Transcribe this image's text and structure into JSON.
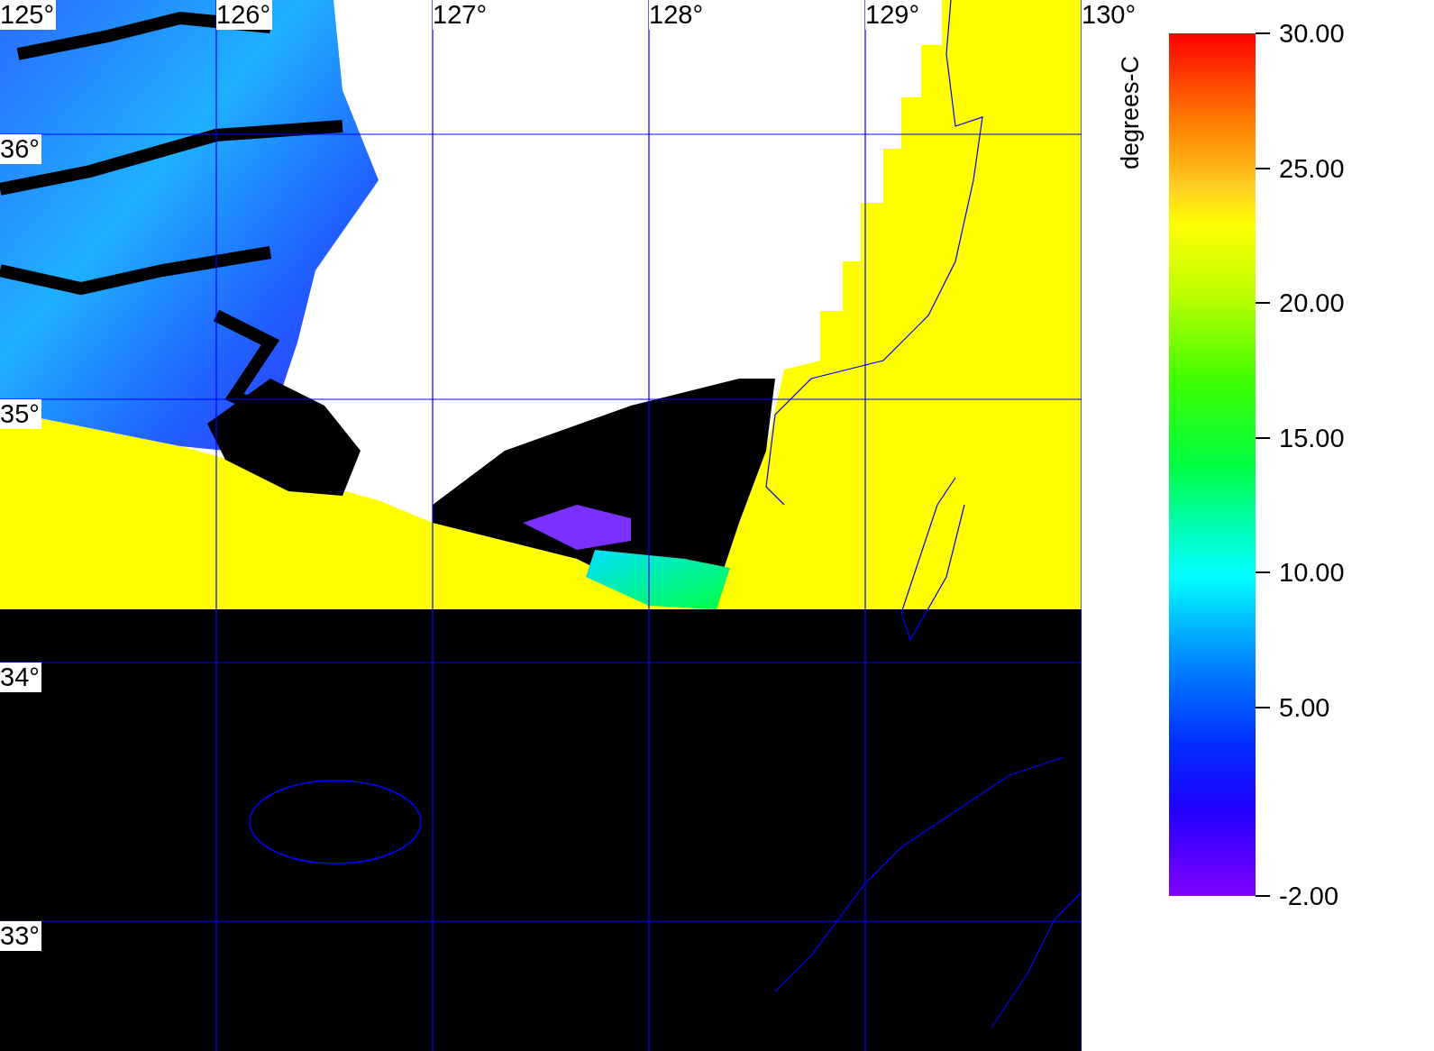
{
  "map": {
    "lon_labels": [
      "125°",
      "126°",
      "127°",
      "128°",
      "129°",
      "130°"
    ],
    "lat_labels": [
      "36°",
      "35°",
      "34°",
      "33°"
    ]
  },
  "colorbar": {
    "title": "degrees-C",
    "ticks": [
      "30.00",
      "25.00",
      "20.00",
      "15.00",
      "10.00",
      "5.00",
      "-2.00"
    ]
  }
}
